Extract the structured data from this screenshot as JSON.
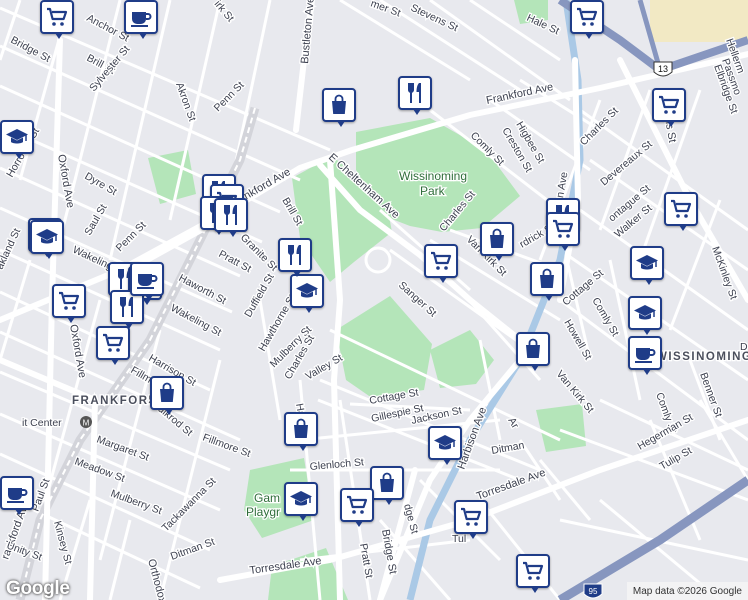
{
  "map": {
    "neighborhoods": {
      "wissinoming": "WISSINOMING",
      "frankford": "FRANKFORD"
    },
    "parks": {
      "wissinoming_park_l1": "Wissinoming",
      "wissinoming_park_l2": "Park",
      "gambrel_l1": "Gam",
      "gambrel_l2": "Playgr"
    },
    "transit": {
      "center": "it Center"
    },
    "roads": {
      "frankford_ave_n": "Frankford Ave",
      "frankford_ave_w": "Frankford Ave",
      "frankford_ave_sw": "rankford Ave",
      "cheltenham": "E Cheltenham Ave",
      "oxford_ave": "Oxford Ave",
      "oxford_ave_2": "Oxford Ave",
      "bustleton": "Bustleton Ave",
      "torresdale_w": "Torresdale Ave",
      "torresdale_e": "Torresdale Ave",
      "harbison": "Harbison Ave",
      "robbins": "Robbins St",
      "bridge_s": "Bridge St",
      "orthodox": "Orthodox"
    },
    "streets": {
      "kirk_top": "irk St",
      "stevens": "Stevens St",
      "mer": "mer St",
      "hale": "Hale St",
      "anchor": "Anchor St",
      "bridge": "Bridge St",
      "brill": "Brill St",
      "akron": "Akron St",
      "sylvester": "Sylvester St",
      "penn": "Penn St",
      "horrocks": "Horrocks St",
      "dyre": "Dyre St",
      "saul": "Saul St",
      "oakland": "akland St",
      "wakeling": "Wakeling St",
      "wakeling2": "Wakeling St",
      "penn2": "Penn St",
      "haworth": "Haworth St",
      "pratt": "Pratt St",
      "granite": "Granite St",
      "brill2": "Brill St",
      "harrison": "Harrison St",
      "duffield": "Duffield St",
      "hawthorne": "Hawthorne St",
      "mulberry": "Mulberry St",
      "charles": "Charles St",
      "valley": "Valley St",
      "fillmore": "Fillmore St",
      "foulkrod": "Foulkrod St",
      "fillm": "Fillm",
      "margaret": "Margaret St",
      "meadow": "Meadow St",
      "mulberry2": "Mulberry St",
      "tackawanna": "Tackawanna St",
      "ditman": "Ditman St",
      "paul": "Paul St",
      "kinsey": "Kinsey St",
      "unity": "Unity St",
      "glenloch": "Glenloch St",
      "ha": "Ha",
      "cottage": "Cottage St",
      "gillespie": "Gillespie St",
      "jackson": "Jackson St",
      "ditman2": "Ditman",
      "pratt2": "Pratt St",
      "dge": "dge St",
      "sanger": "Sanger St",
      "charles2": "Charles St",
      "comly": "Comly St",
      "creston": "Creston St",
      "higbee": "Higbee St",
      "van_kirk": "Van Kirk St",
      "frank_ave_v": "on Ave",
      "charles3": "Charles St",
      "devereaux": "Devereaux St",
      "montague": "ontague St",
      "walker": "Walker St",
      "dirck": "rdrick St",
      "cottage2": "Cottage St",
      "comly2": "Comly St",
      "howell": "Howell St",
      "van_kirk2": "Van Kirk St",
      "comly3": "Comly St",
      "hegerman": "Hegerman St",
      "tulip": "Tulip St",
      "benner": "Benner St",
      "mckinley": "McKinley St",
      "hellerman": "Hellerm",
      "passmore": "Passmo",
      "elbridge": "Elbridge St",
      "tul": "Tul",
      "ar": "Ar",
      "d": "D"
    },
    "shields": {
      "us13": "13",
      "i95": "95"
    },
    "footer": {
      "logo": "Google",
      "attribution": "Map data ©2026 Google"
    },
    "colors": {
      "marker_border": "#1f3c88",
      "park": "#b4e5b9",
      "water": "#aac9e6",
      "highway": "#8796bf"
    }
  },
  "markers": [
    {
      "type": "shopping",
      "icon": "cart-icon"
    },
    {
      "type": "cafe",
      "icon": "cup-icon"
    },
    {
      "type": "shopping",
      "icon": "cart-icon"
    },
    {
      "type": "school",
      "icon": "school-icon"
    },
    {
      "type": "school",
      "icon": "school-icon"
    },
    {
      "type": "shopping",
      "icon": "bag-icon"
    },
    {
      "type": "restaurant",
      "icon": "fork-knife-icon"
    },
    {
      "type": "shopping",
      "icon": "cart-icon"
    },
    {
      "type": "restaurant",
      "icon": "fork-knife-icon"
    },
    {
      "type": "shopping",
      "icon": "cart-icon"
    },
    {
      "type": "restaurant",
      "icon": "fork-knife-icon"
    },
    {
      "type": "restaurant",
      "icon": "fork-knife-icon"
    },
    {
      "type": "school",
      "icon": "school-icon"
    },
    {
      "type": "shopping",
      "icon": "cart-icon"
    },
    {
      "type": "restaurant",
      "icon": "fork-knife-icon"
    },
    {
      "type": "shopping",
      "icon": "cart-icon"
    },
    {
      "type": "restaurant",
      "icon": "fork-knife-icon"
    },
    {
      "type": "shopping",
      "icon": "cart-icon"
    },
    {
      "type": "shopping",
      "icon": "bag-icon"
    },
    {
      "type": "shopping",
      "icon": "bag-icon"
    },
    {
      "type": "shopping",
      "icon": "cart-icon"
    },
    {
      "type": "shopping",
      "icon": "bag-icon"
    },
    {
      "type": "restaurant",
      "icon": "fork-knife-icon"
    },
    {
      "type": "shopping",
      "icon": "cart-icon"
    },
    {
      "type": "shopping",
      "icon": "cart-icon"
    },
    {
      "type": "school",
      "icon": "school-icon"
    },
    {
      "type": "school",
      "icon": "school-icon"
    },
    {
      "type": "shopping",
      "icon": "bag-icon"
    },
    {
      "type": "cafe",
      "icon": "cup-icon"
    },
    {
      "type": "shopping",
      "icon": "bag-icon"
    },
    {
      "type": "school",
      "icon": "school-icon"
    },
    {
      "type": "restaurant",
      "icon": "fork-knife-icon"
    },
    {
      "type": "cafe",
      "icon": "cup-icon"
    },
    {
      "type": "shopping",
      "icon": "bag-icon"
    },
    {
      "type": "school",
      "icon": "school-icon"
    },
    {
      "type": "shopping",
      "icon": "cart-icon"
    },
    {
      "type": "shopping",
      "icon": "cart-icon"
    },
    {
      "type": "shopping",
      "icon": "cart-icon"
    },
    {
      "type": "school",
      "icon": "school-icon"
    },
    {
      "type": "cafe",
      "icon": "cup-icon"
    }
  ]
}
